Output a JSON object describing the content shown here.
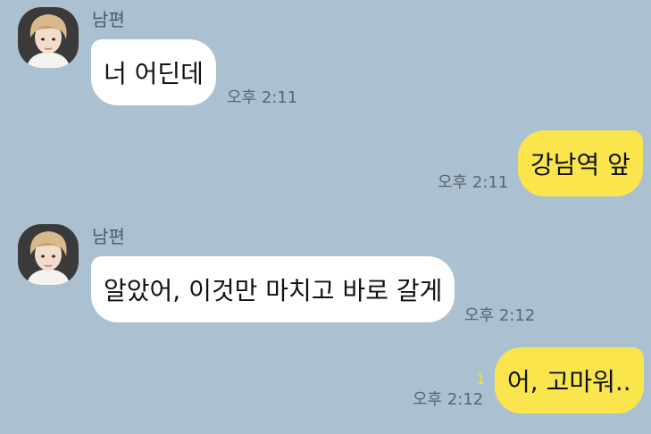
{
  "colors": {
    "background": "#abc1d1",
    "incoming_bubble": "#ffffff",
    "outgoing_bubble": "#fbe54d",
    "unread": "#f5df28"
  },
  "messages": [
    {
      "direction": "incoming",
      "sender": "남편",
      "avatar": "profile-photo",
      "text": "너 어딘데",
      "time": "오후 2:11"
    },
    {
      "direction": "outgoing",
      "text": "강남역 앞",
      "time": "오후 2:11"
    },
    {
      "direction": "incoming",
      "sender": "남편",
      "avatar": "profile-photo",
      "text": "알았어, 이것만 마치고 바로 갈게",
      "time": "오후 2:12"
    },
    {
      "direction": "outgoing",
      "text": "어, 고마워..",
      "time": "오후 2:12",
      "unread_count": "1"
    }
  ]
}
